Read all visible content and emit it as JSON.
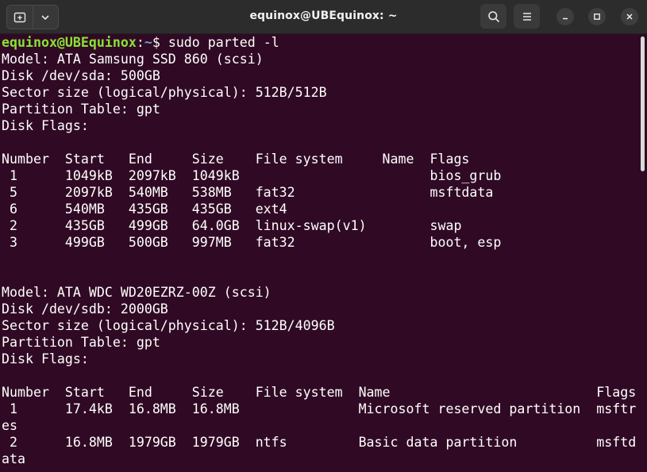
{
  "window": {
    "title": "equinox@UBEquinox: ~"
  },
  "prompt": {
    "user_host": "equinox@UBEquinox",
    "sep": ":",
    "path": "~",
    "symbol": "$ ",
    "command": "sudo parted -l"
  },
  "terminal_lines": [
    "Model: ATA Samsung SSD 860 (scsi)",
    "Disk /dev/sda: 500GB",
    "Sector size (logical/physical): 512B/512B",
    "Partition Table: gpt",
    "Disk Flags: ",
    "",
    "Number  Start   End     Size    File system     Name  Flags",
    " 1      1049kB  2097kB  1049kB                        bios_grub",
    " 5      2097kB  540MB   538MB   fat32                 msftdata",
    " 6      540MB   435GB   435GB   ext4",
    " 2      435GB   499GB   64.0GB  linux-swap(v1)        swap",
    " 3      499GB   500GB   997MB   fat32                 boot, esp",
    "",
    "",
    "Model: ATA WDC WD20EZRZ-00Z (scsi)",
    "Disk /dev/sdb: 2000GB",
    "Sector size (logical/physical): 512B/4096B",
    "Partition Table: gpt",
    "Disk Flags: ",
    "",
    "Number  Start   End     Size    File system  Name                          Flags",
    " 1      17.4kB  16.8MB  16.8MB               Microsoft reserved partition  msftr",
    "es",
    " 2      16.8MB  1979GB  1979GB  ntfs         Basic data partition          msftd",
    "ata"
  ],
  "scrollbar": {
    "position_fraction": 0.0
  }
}
